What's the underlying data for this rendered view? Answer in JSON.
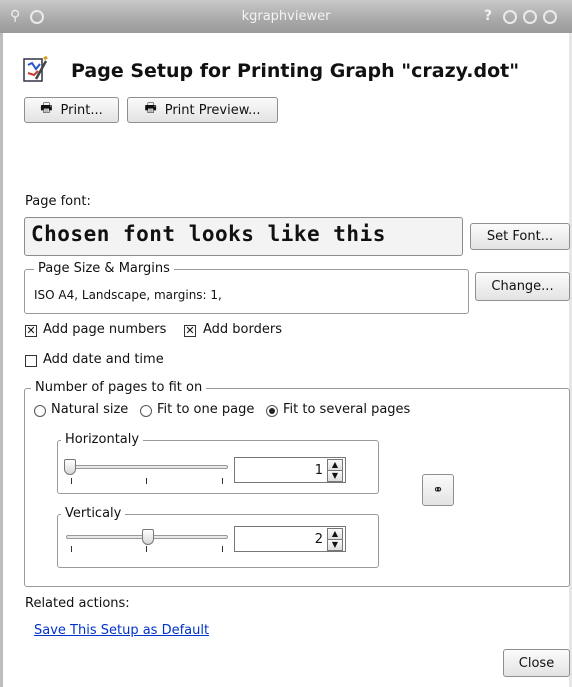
{
  "window": {
    "title": "kgraphviewer"
  },
  "header": {
    "title": "Page Setup for Printing Graph \"crazy.dot\""
  },
  "toolbar": {
    "print_label": "Print...",
    "print_preview_label": "Print Preview..."
  },
  "font": {
    "label": "Page font:",
    "sample": "Chosen font looks like this",
    "set_font_label": "Set Font..."
  },
  "page_size": {
    "legend": "Page Size & Margins",
    "value": "ISO A4, Landscape, margins: 1,",
    "change_label": "Change..."
  },
  "options": {
    "add_page_numbers": {
      "label": "Add page numbers",
      "checked": true
    },
    "add_borders": {
      "label": "Add borders",
      "checked": true
    },
    "add_date_time": {
      "label": "Add date and time",
      "checked": false
    }
  },
  "fit": {
    "legend": "Number of pages to fit on",
    "radios": [
      {
        "label": "Natural size",
        "selected": false
      },
      {
        "label": "Fit to one page",
        "selected": false
      },
      {
        "label": "Fit to several pages",
        "selected": true
      }
    ],
    "horizontal": {
      "legend": "Horizontaly",
      "value": "1",
      "slider_fraction": 0.0
    },
    "vertical": {
      "legend": "Verticaly",
      "value": "2",
      "slider_fraction": 0.5
    }
  },
  "related": {
    "label": "Related actions:",
    "save_default_link": "Save This Setup as Default"
  },
  "footer": {
    "close_label": "Close"
  },
  "colors": {
    "link": "#0033cc",
    "titlebar": "#a9a9a9"
  }
}
